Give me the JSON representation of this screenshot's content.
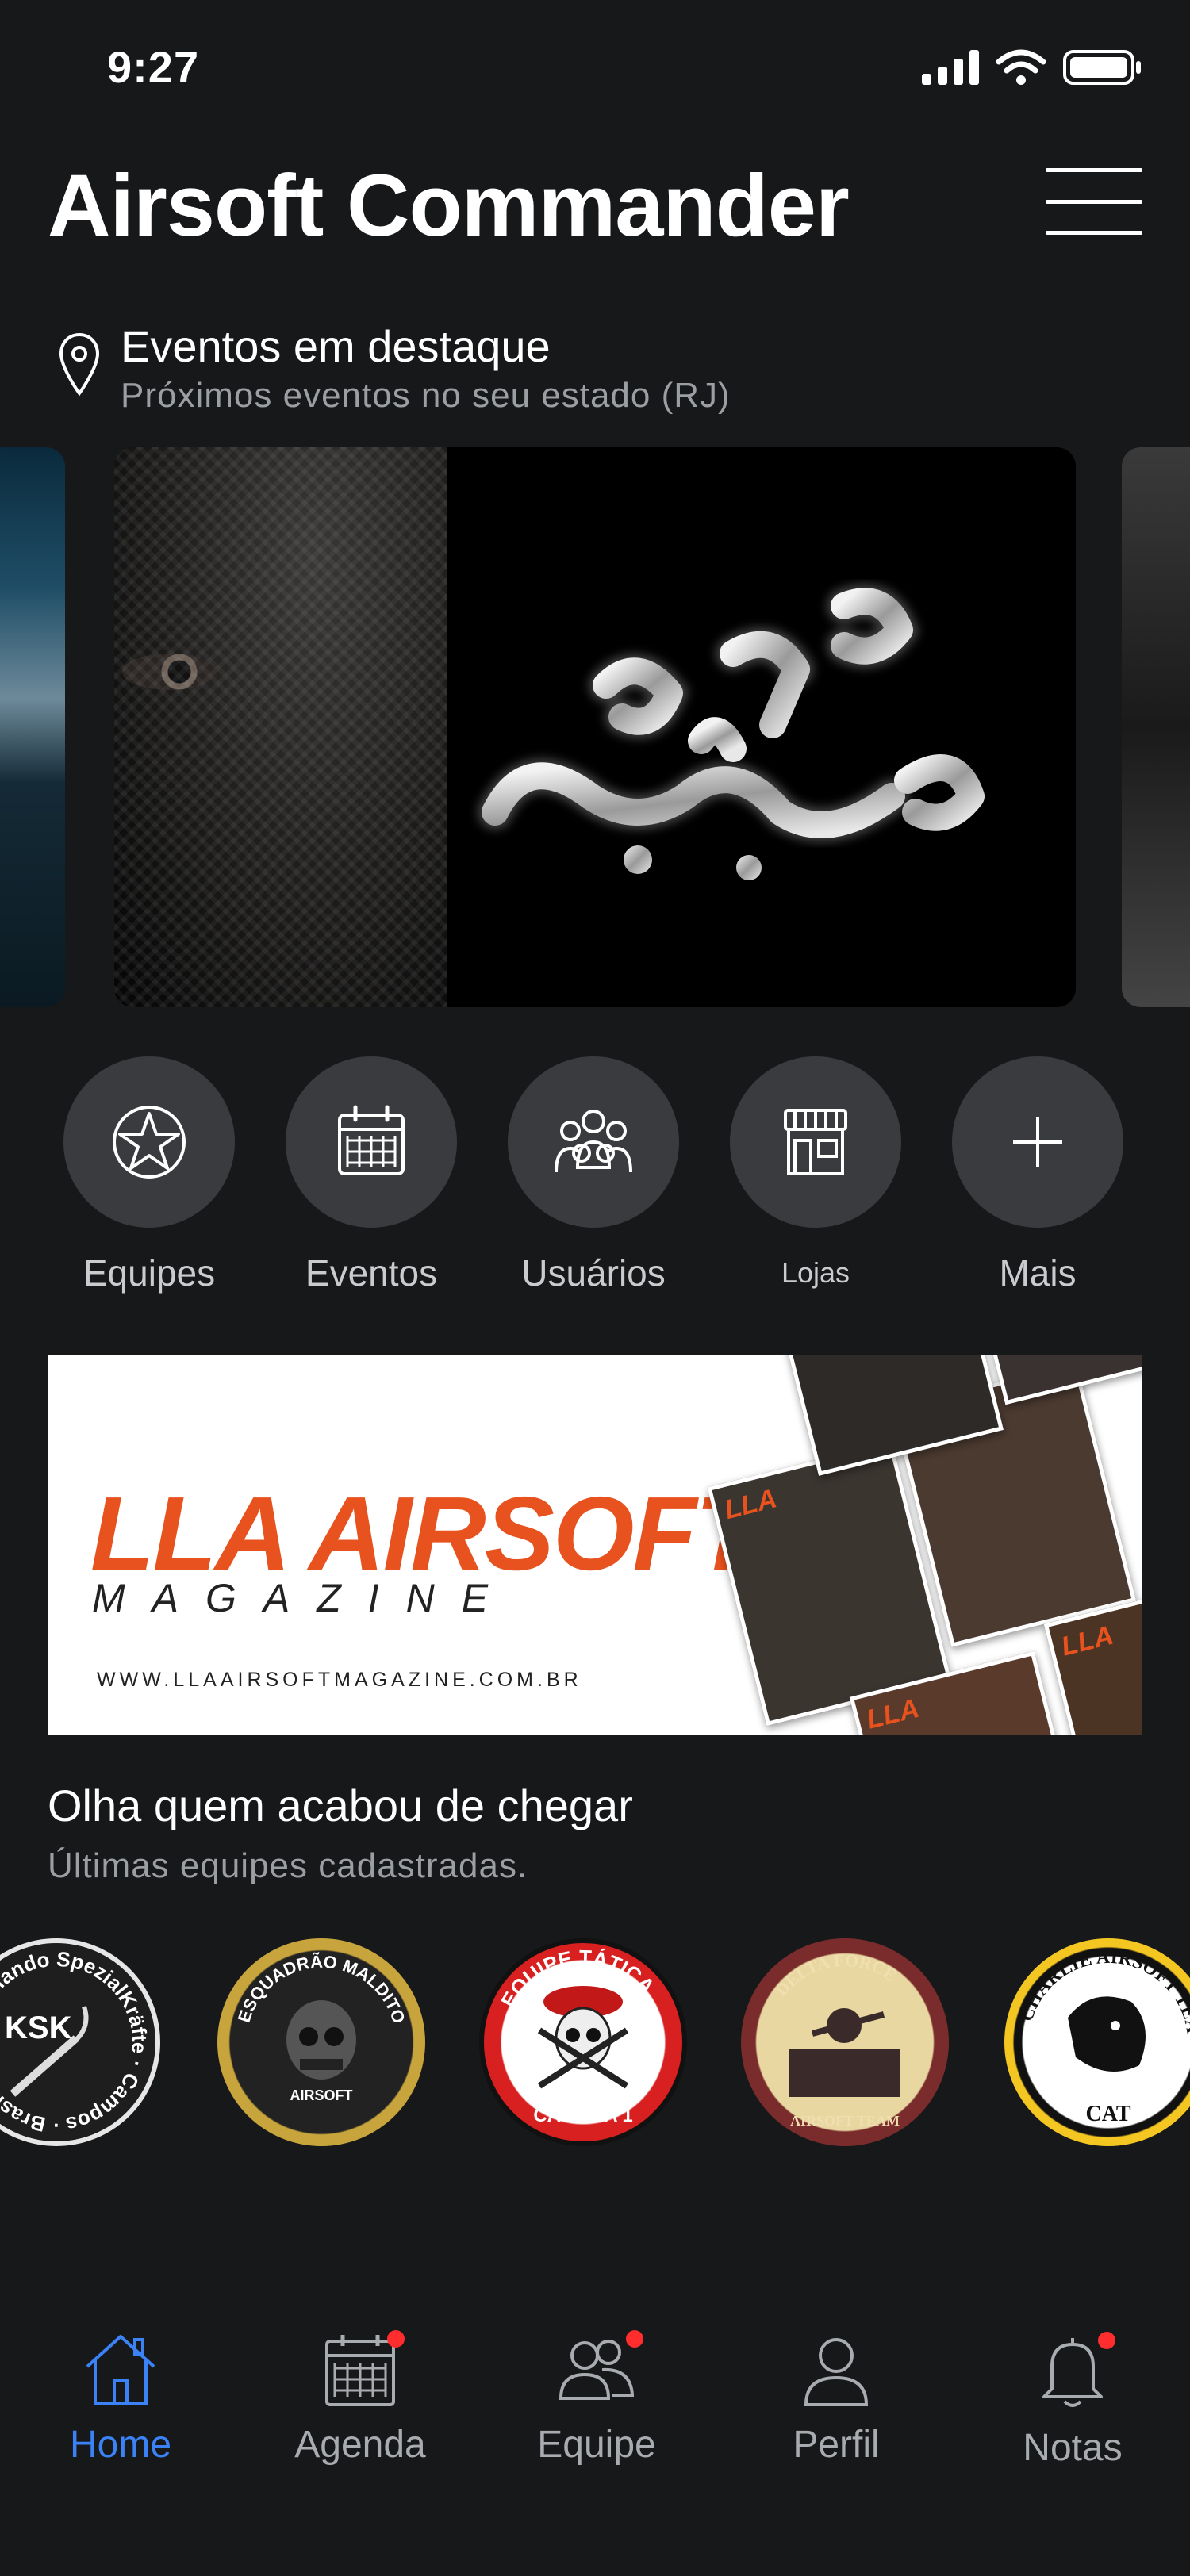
{
  "status_bar": {
    "time": "9:27"
  },
  "header": {
    "title": "Airsoft Commander"
  },
  "featured": {
    "title": "Eventos em destaque",
    "subtitle": "Próximos eventos no seu estado (RJ)"
  },
  "quick_actions": [
    {
      "label": "Equipes",
      "icon": "star-icon"
    },
    {
      "label": "Eventos",
      "icon": "calendar-icon"
    },
    {
      "label": "Usuários",
      "icon": "users-icon"
    },
    {
      "label": "Lojas",
      "icon": "store-icon"
    },
    {
      "label": "Mais",
      "icon": "plus-icon"
    }
  ],
  "banner": {
    "brand": "LLA AIRSOFT",
    "tagline": "MAGAZINE",
    "url": "WWW.LLAAIRSOFTMAGAZINE.COM.BR"
  },
  "newcomers": {
    "title": "Olha quem acabou de chegar",
    "subtitle": "Últimas equipes cadastradas.",
    "teams": [
      {
        "text": "KSK",
        "ring_text": "Kommando SpezialKräfte · Campos · Brasil"
      },
      {
        "text": "AIRSOFT",
        "ring_text": "ESQUADRÃO MALDITO"
      },
      {
        "text": "CAVEIRA 1",
        "ring_text": "EQUIPE TÁTICA"
      },
      {
        "text": "AIRSOFT TEAM",
        "ring_text": "DELTA FORCE"
      },
      {
        "text": "CAT",
        "ring_text": "CHARLIE AIRSOFT TEAM"
      }
    ]
  },
  "bottom_nav": [
    {
      "label": "Home",
      "icon": "home-icon",
      "active": true,
      "badge": false
    },
    {
      "label": "Agenda",
      "icon": "calendar-icon",
      "active": false,
      "badge": true
    },
    {
      "label": "Equipe",
      "icon": "team-icon",
      "active": false,
      "badge": true
    },
    {
      "label": "Perfil",
      "icon": "profile-icon",
      "active": false,
      "badge": false
    },
    {
      "label": "Notas",
      "icon": "bell-icon",
      "active": false,
      "badge": true
    }
  ],
  "colors": {
    "background": "#17181a",
    "accent": "#3b82f6",
    "brand_orange": "#e8521f",
    "badge_red": "#ff2d2d"
  }
}
